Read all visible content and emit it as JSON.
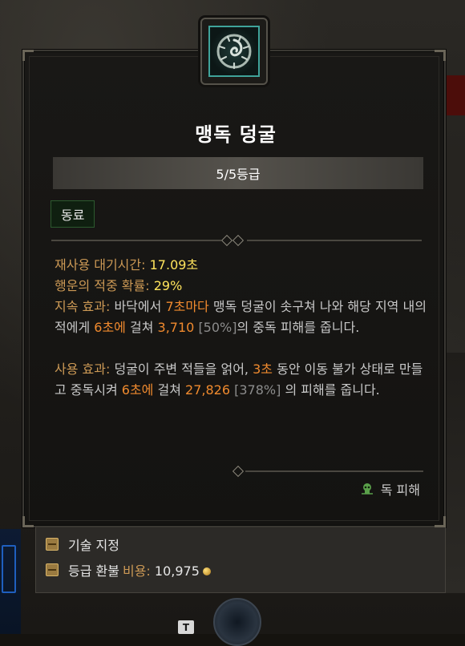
{
  "skill": {
    "name": "맹독 덩굴",
    "rank": "5/5등급",
    "tag": "동료",
    "icon": "poison-vine-icon"
  },
  "stats": {
    "cooldown_label": "재사용 대기시간:",
    "cooldown_value": "17.09초",
    "lucky_hit_label": "행운의 적중 확률:",
    "lucky_hit_value": "29%"
  },
  "passive": {
    "label": "지속 효과:",
    "t1": "바닥에서",
    "n1": "7초마다",
    "t2": "맹독 덩굴이 솟구쳐 나와 해당 지역 내의 적에게",
    "n2": "6초에",
    "t3": "걸쳐",
    "n3": "3,710",
    "p1": "[50%]",
    "t4": "의 중독 피해를 줍니다."
  },
  "active": {
    "label": "사용 효과:",
    "t1": "덩굴이 주변 적들을 얽어,",
    "n1": "3초",
    "t2": "동안 이동 불가 상태로 만들고 중독시켜",
    "n2": "6초에",
    "t3": "걸쳐",
    "n3": "27,826",
    "p1": "[378%]",
    "t4": "의 피해를 줍니다."
  },
  "damage_type": {
    "label": "독 피해",
    "icon": "poison-skull-icon"
  },
  "footer": {
    "assign_label": "기술 지정",
    "refund_label": "등급 환불",
    "cost_label": "비용:",
    "cost_value": "10,975"
  },
  "hotkey": "T",
  "colors": {
    "label_orange": "#cc9955",
    "value_yellow": "#ffe45c",
    "number_orange": "#f08a2e",
    "percent_gray": "#8c8c8c",
    "icon_teal": "#3fa39a"
  }
}
